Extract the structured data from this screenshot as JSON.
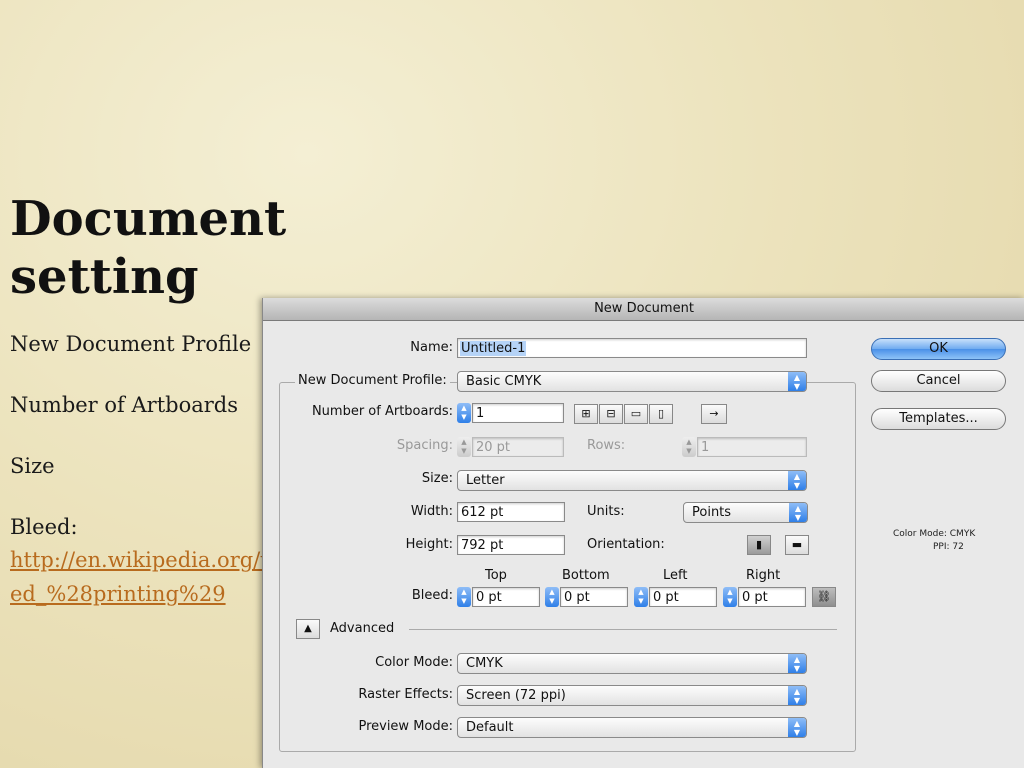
{
  "slide": {
    "title_line1": "Document",
    "title_line2": "setting",
    "bullets": [
      "New Document Profile",
      "Number of Artboards",
      "Size"
    ],
    "bleed_label": "Bleed:",
    "bleed_link_line1": "http://en.wikipedia.org/wiki/Ble",
    "bleed_link_line2": "ed_%28printing%29"
  },
  "dialog": {
    "title": "New Document",
    "name_label": "Name:",
    "name_value": "Untitled-1",
    "profile_label": "New Document Profile:",
    "profile_value": "Basic CMYK",
    "artboards_label": "Number of Artboards:",
    "artboards_value": "1",
    "spacing_label": "Spacing:",
    "spacing_value": "20 pt",
    "rows_label": "Rows:",
    "rows_value": "1",
    "size_label": "Size:",
    "size_value": "Letter",
    "width_label": "Width:",
    "width_value": "612 pt",
    "units_label": "Units:",
    "units_value": "Points",
    "height_label": "Height:",
    "height_value": "792 pt",
    "orientation_label": "Orientation:",
    "bleed_label": "Bleed:",
    "bleed_headers": [
      "Top",
      "Bottom",
      "Left",
      "Right"
    ],
    "bleed_values": [
      "0 pt",
      "0 pt",
      "0 pt",
      "0 pt"
    ],
    "advanced_label": "Advanced",
    "color_mode_label": "Color Mode:",
    "color_mode_value": "CMYK",
    "raster_label": "Raster Effects:",
    "raster_value": "Screen (72 ppi)",
    "preview_label": "Preview Mode:",
    "preview_value": "Default",
    "ok_label": "OK",
    "cancel_label": "Cancel",
    "templates_label": "Templates...",
    "info_color_mode": "Color Mode: CMYK",
    "info_ppi": "PPI: 72"
  },
  "colors": {
    "link": "#b86b1e",
    "accent_blue": "#4a90e8"
  }
}
